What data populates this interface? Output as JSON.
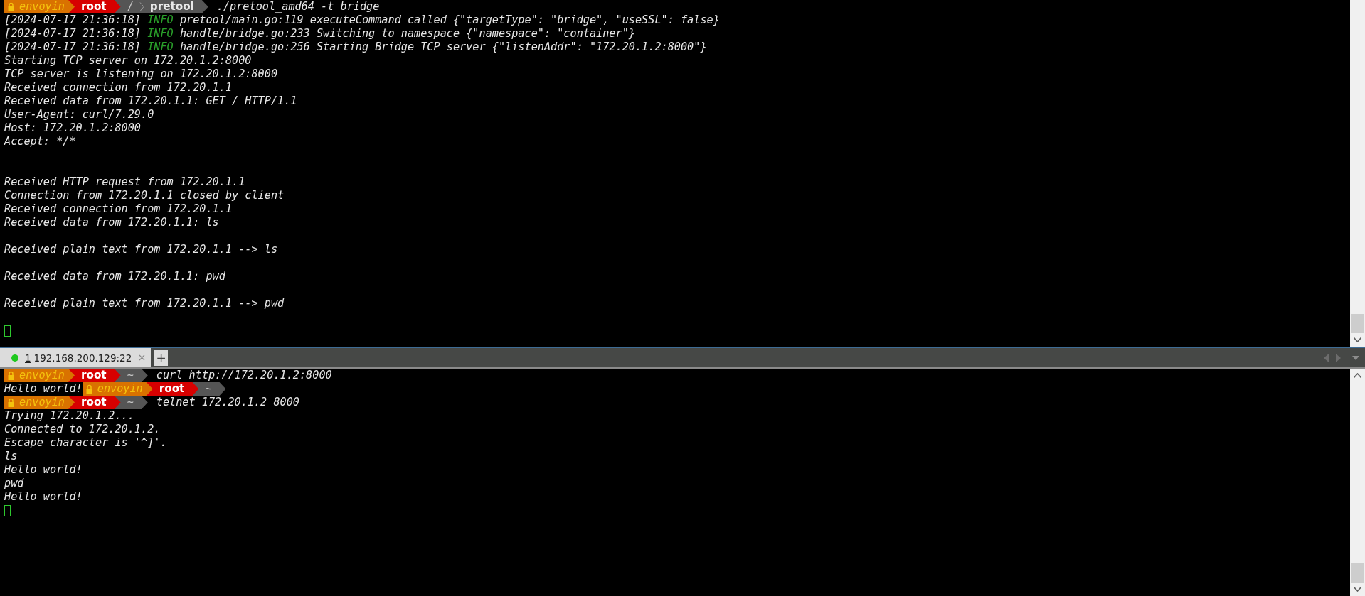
{
  "top_pane": {
    "lines": [
      {
        "kind": "prompt",
        "user": "envoyin",
        "host": "root",
        "path": [
          "/",
          "pretool"
        ],
        "command": "./pretool_amd64 -t bridge"
      },
      {
        "kind": "log",
        "timestamp": "[2024-07-17 21:36:18]",
        "level": "INFO",
        "message": "pretool/main.go:119 executeCommand called {\"targetType\": \"bridge\", \"useSSL\": false}"
      },
      {
        "kind": "log",
        "timestamp": "[2024-07-17 21:36:18]",
        "level": "INFO",
        "message": "handle/bridge.go:233 Switching to namespace {\"namespace\": \"container\"}"
      },
      {
        "kind": "log",
        "timestamp": "[2024-07-17 21:36:18]",
        "level": "INFO",
        "message": "handle/bridge.go:256 Starting Bridge TCP server {\"listenAddr\": \"172.20.1.2:8000\"}"
      },
      {
        "kind": "text",
        "text": "Starting TCP server on 172.20.1.2:8000"
      },
      {
        "kind": "text",
        "text": "TCP server is listening on 172.20.1.2:8000"
      },
      {
        "kind": "text",
        "text": "Received connection from 172.20.1.1"
      },
      {
        "kind": "text",
        "text": "Received data from 172.20.1.1: GET / HTTP/1.1"
      },
      {
        "kind": "text",
        "text": "User-Agent: curl/7.29.0"
      },
      {
        "kind": "text",
        "text": "Host: 172.20.1.2:8000"
      },
      {
        "kind": "text",
        "text": "Accept: */*"
      },
      {
        "kind": "blank"
      },
      {
        "kind": "blank"
      },
      {
        "kind": "text",
        "text": "Received HTTP request from 172.20.1.1"
      },
      {
        "kind": "text",
        "text": "Connection from 172.20.1.1 closed by client"
      },
      {
        "kind": "text",
        "text": "Received connection from 172.20.1.1"
      },
      {
        "kind": "text",
        "text": "Received data from 172.20.1.1: ls"
      },
      {
        "kind": "blank"
      },
      {
        "kind": "text",
        "text": "Received plain text from 172.20.1.1 --> ls"
      },
      {
        "kind": "blank"
      },
      {
        "kind": "text",
        "text": "Received data from 172.20.1.1: pwd"
      },
      {
        "kind": "blank"
      },
      {
        "kind": "text",
        "text": "Received plain text from 172.20.1.1 --> pwd"
      },
      {
        "kind": "blank"
      },
      {
        "kind": "cursor"
      }
    ]
  },
  "tab_bar": {
    "tabs": [
      {
        "number": "1",
        "label": "192.168.200.129:22",
        "selected": true,
        "color": "#1ec81e"
      }
    ],
    "new_tab": "+"
  },
  "bottom_pane": {
    "lines": [
      {
        "kind": "prompt",
        "user": "envoyin",
        "host": "root",
        "path": [
          "~"
        ],
        "command": "curl http://172.20.1.2:8000"
      },
      {
        "kind": "prompt",
        "output": "Hello world!",
        "user": "envoyin",
        "host": "root",
        "path": [
          "~"
        ]
      },
      {
        "kind": "prompt",
        "user": "envoyin",
        "host": "root",
        "path": [
          "~"
        ],
        "command": "telnet 172.20.1.2 8000"
      },
      {
        "kind": "text",
        "text": "Trying 172.20.1.2..."
      },
      {
        "kind": "text",
        "text": "Connected to 172.20.1.2."
      },
      {
        "kind": "text",
        "text": "Escape character is '^]'."
      },
      {
        "kind": "text",
        "text": "ls"
      },
      {
        "kind": "text",
        "text": "Hello world!"
      },
      {
        "kind": "text",
        "text": "pwd"
      },
      {
        "kind": "text",
        "text": "Hello world!"
      },
      {
        "kind": "cursor"
      }
    ]
  }
}
